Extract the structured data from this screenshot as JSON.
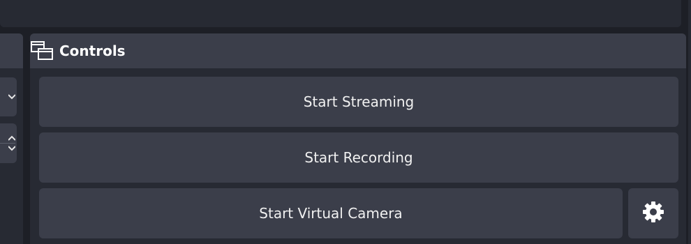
{
  "controls_dock": {
    "title": "Controls",
    "icon": "dock-window-icon",
    "buttons": {
      "start_streaming": "Start Streaming",
      "start_recording": "Start Recording",
      "start_virtual_camera": "Start Virtual Camera",
      "virtual_camera_settings_icon": "gear-icon"
    }
  },
  "left_dock": {
    "button_icons": [
      "chevron-down-icon",
      "chevron-up-down-icon"
    ]
  },
  "colors": {
    "background": "#1d1f26",
    "panel": "#272a33",
    "button": "#3b3e4a",
    "text": "#ffffff"
  }
}
